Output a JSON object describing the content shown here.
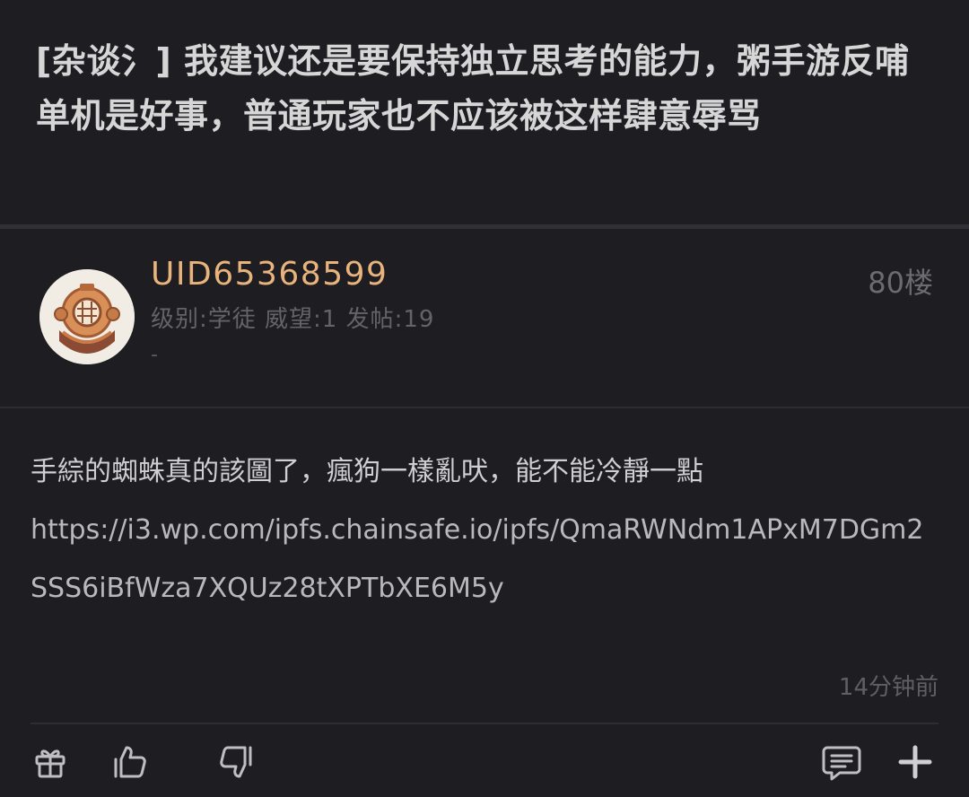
{
  "thread": {
    "title": "[杂谈氵] 我建议还是要保持独立思考的能力，粥手游反哺单机是好事，普通玩家也不应该被这样肆意辱骂"
  },
  "post": {
    "author": {
      "username": "UID65368599",
      "stats": "级别:学徒 威望:1 发帖:19",
      "signature": "-",
      "avatar_icon": "diving-helmet-icon"
    },
    "floor": "80楼",
    "content_text": "手綜的蜘蛛真的該圖了，瘋狗一樣亂吠，能不能冷靜一點",
    "content_link": "https://i3.wp.com/ipfs.chainsafe.io/ipfs/QmaRWNdm1APxM7DGm2SSS6iBfWza7XQUz28tXPTbXE6M5y",
    "time": "14分钟前"
  },
  "actions": {
    "gift_icon": "gift-icon",
    "like_icon": "thumbs-up-icon",
    "dislike_icon": "thumbs-down-icon",
    "reply_icon": "comment-icon",
    "more_icon": "plus-icon"
  },
  "colors": {
    "background": "#1d1d22",
    "username": "#e9b37c",
    "title": "#d6d6d6",
    "body_text": "#cfcfd2",
    "muted": "#636368"
  }
}
